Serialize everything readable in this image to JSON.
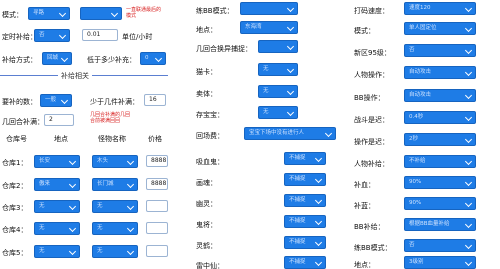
{
  "left": {
    "mode_label": "模式：",
    "mode_value": "寻路",
    "mode_value2": "",
    "mode_note": "一直联通最后的模式",
    "timed_label": "定时补给：",
    "timed_value": "否",
    "timed_input": "0.01",
    "timed_unit": "单位/小时",
    "supply_method_label": "补给方式：",
    "supply_method_value": "回城",
    "below_label": "低于多少补充：",
    "below_value": "0",
    "supply_section": "补给相关",
    "supply_count_label": "要补的数：",
    "supply_count_value": "一般",
    "min_count_label": "少于几件补满：",
    "min_count_value": "16",
    "hp_threshold_label": "几回合补满：",
    "hp_threshold_value": "2",
    "hp_note": "几回合补满的几回合前被满回回",
    "warehouse_headers": [
      "仓库号",
      "地点",
      "怪物名称",
      "价格"
    ],
    "warehouse_rows": [
      {
        "name": "仓库1：",
        "location": "长安",
        "item": "木头",
        "price": "8888"
      },
      {
        "name": "仓库2：",
        "location": "傲来",
        "item": "长门城",
        "price": "8888"
      },
      {
        "name": "仓库3：",
        "location": "无",
        "item": "无",
        "price": ""
      },
      {
        "name": "仓库4：",
        "location": "无",
        "item": "无",
        "price": ""
      },
      {
        "name": "仓库5：",
        "location": "无",
        "item": "无",
        "price": ""
      }
    ]
  },
  "middle": {
    "rows": [
      {
        "label": "练BB模式：",
        "value": ""
      },
      {
        "label": "地点：",
        "value": "东海湾"
      },
      {
        "label": "几回合换异捕捉：",
        "value": ""
      },
      {
        "label": "猫卡：",
        "value": "无"
      },
      {
        "label": "卖体：",
        "value": "无"
      },
      {
        "label": "存宝宝：",
        "value": "无"
      },
      {
        "label": "回场费：",
        "value": "宝宝下场中没有进行人"
      },
      {
        "label": "吸血鬼：",
        "value": "不捕捉"
      },
      {
        "label": "画魂：",
        "value": "不捕捉"
      },
      {
        "label": "幽灵：",
        "value": "不捕捉"
      },
      {
        "label": "鬼将：",
        "value": "不捕捉"
      },
      {
        "label": "灵鹤：",
        "value": "不捕捉"
      },
      {
        "label": "雷中仙：",
        "value": "不捕捉"
      }
    ]
  },
  "right": {
    "rows": [
      {
        "label": "打码速度：",
        "value": "速度120"
      },
      {
        "label": "模式：",
        "value": "单人固定位"
      },
      {
        "label": "新区95级：",
        "value": "否"
      },
      {
        "label": "人物操作：",
        "value": "自动攻击"
      },
      {
        "label": "BB操作：",
        "value": "自动攻击"
      },
      {
        "label": "战斗是迟：",
        "value": "0.4秒"
      },
      {
        "label": "操作是迟：",
        "value": "2秒"
      },
      {
        "label": "人物补给：",
        "value": "不补给"
      },
      {
        "label": "补血：",
        "value": "90%"
      },
      {
        "label": "补蓝：",
        "value": "90%"
      },
      {
        "label": "BB补给：",
        "value": "根据BB血量补给"
      },
      {
        "label": "练BB模式：",
        "value": "否"
      },
      {
        "label": "地点：",
        "value": "3级别"
      }
    ]
  }
}
